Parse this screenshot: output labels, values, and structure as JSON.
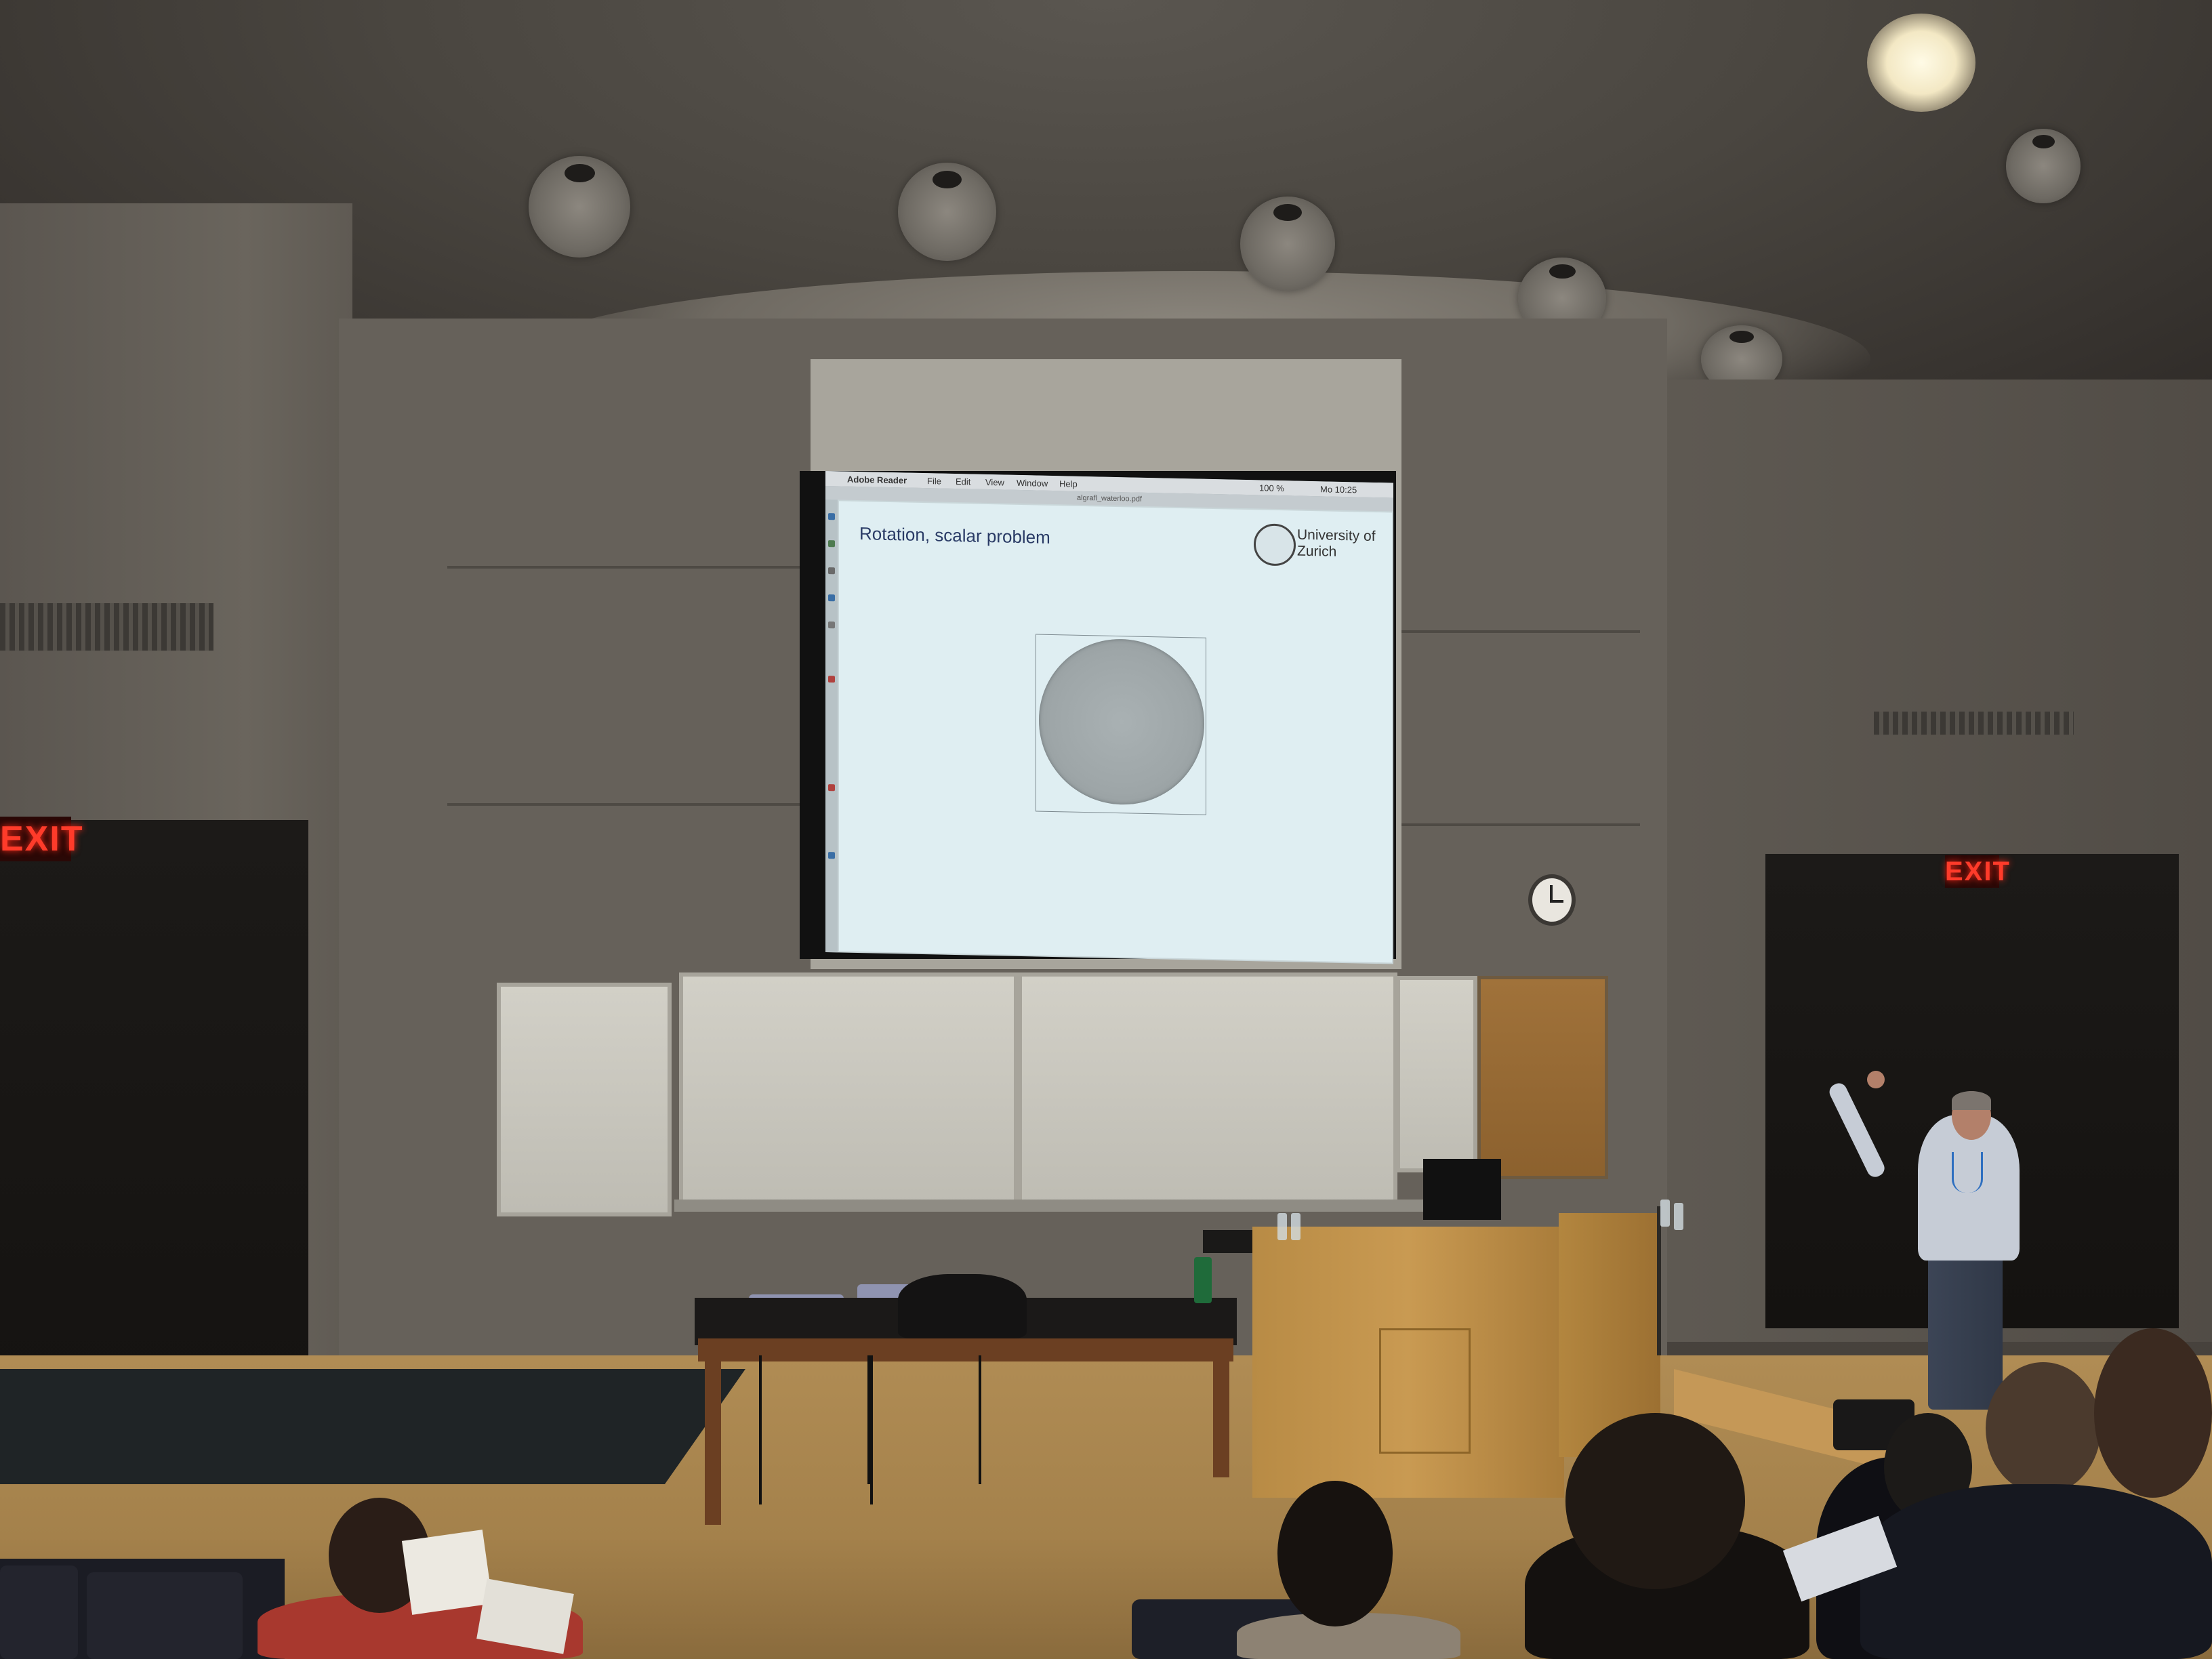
{
  "scene": {
    "exit_sign_left": "EXIT",
    "exit_sign_right": "EXIT"
  },
  "app": {
    "menubar": {
      "apple": "",
      "app_name": "Adobe Reader",
      "file": "File",
      "edit": "Edit",
      "view": "View",
      "window": "Window",
      "help": "Help",
      "zoom": "100 %",
      "clock": "Mo 10:25"
    },
    "document_title": "algrafl_waterloo.pdf"
  },
  "slide": {
    "title": "Rotation, scalar problem",
    "logo_text_line1": "University of",
    "logo_text_line2": "Zurich"
  },
  "colors": {
    "slide_background": "#dfeef2",
    "slide_title": "#2a3b66",
    "exit_red": "#ff3b2a",
    "podium_wood": "#c99a52"
  }
}
